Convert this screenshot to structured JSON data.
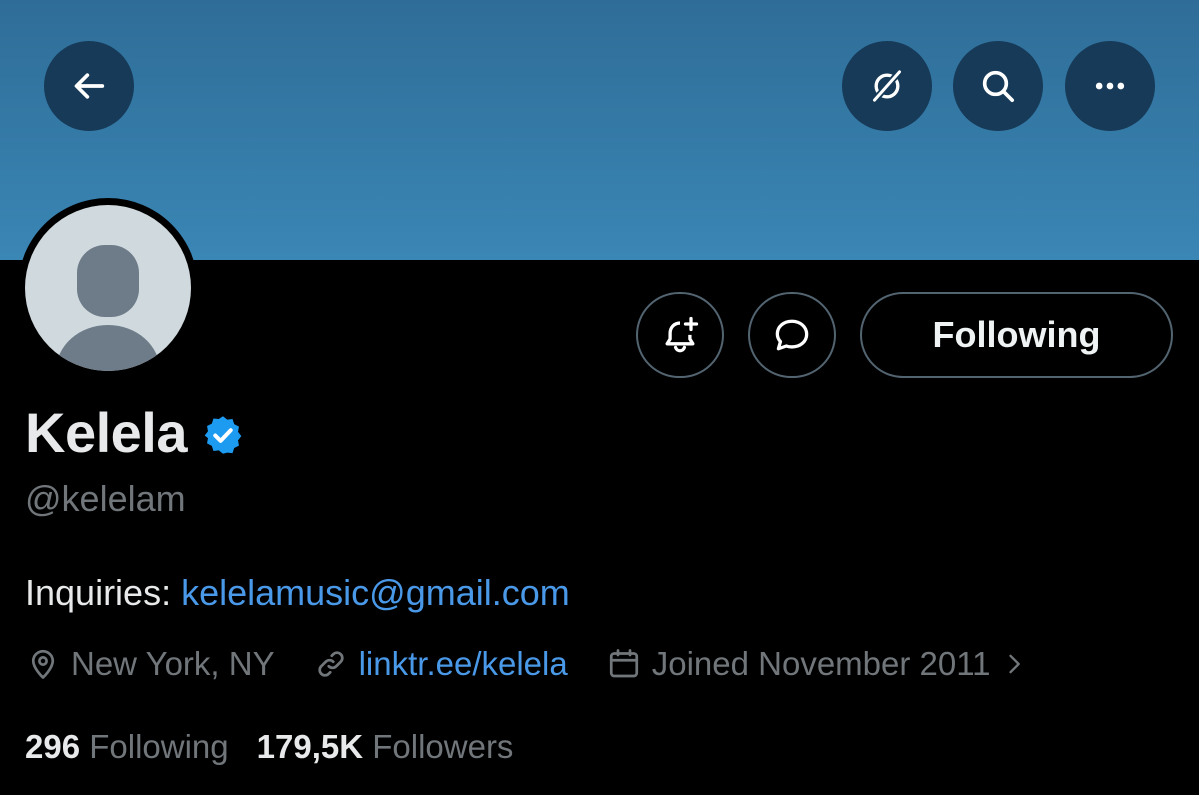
{
  "header": {
    "back_icon": "arrow-left-icon",
    "grok_icon": "grok-icon",
    "search_icon": "search-icon",
    "more_icon": "more-horizontal-icon",
    "banner_color": "#3a86b5",
    "button_bg": "#163a57"
  },
  "profile": {
    "name": "Kelela",
    "handle": "@kelelam",
    "verified_color": "#1d9bf0",
    "bio_prefix": "Inquiries: ",
    "bio_email": "kelelamusic@gmail.com",
    "location": "New York, NY",
    "website": "linktr.ee/kelela",
    "joined": "Joined November 2011"
  },
  "actions": {
    "notify_icon": "bell-plus-icon",
    "message_icon": "message-icon",
    "following_label": "Following"
  },
  "stats": {
    "following_count": "296",
    "following_label": "Following",
    "followers_count": "179,5K",
    "followers_label": "Followers"
  },
  "colors": {
    "link": "#4a99e9",
    "muted": "#71767b"
  }
}
